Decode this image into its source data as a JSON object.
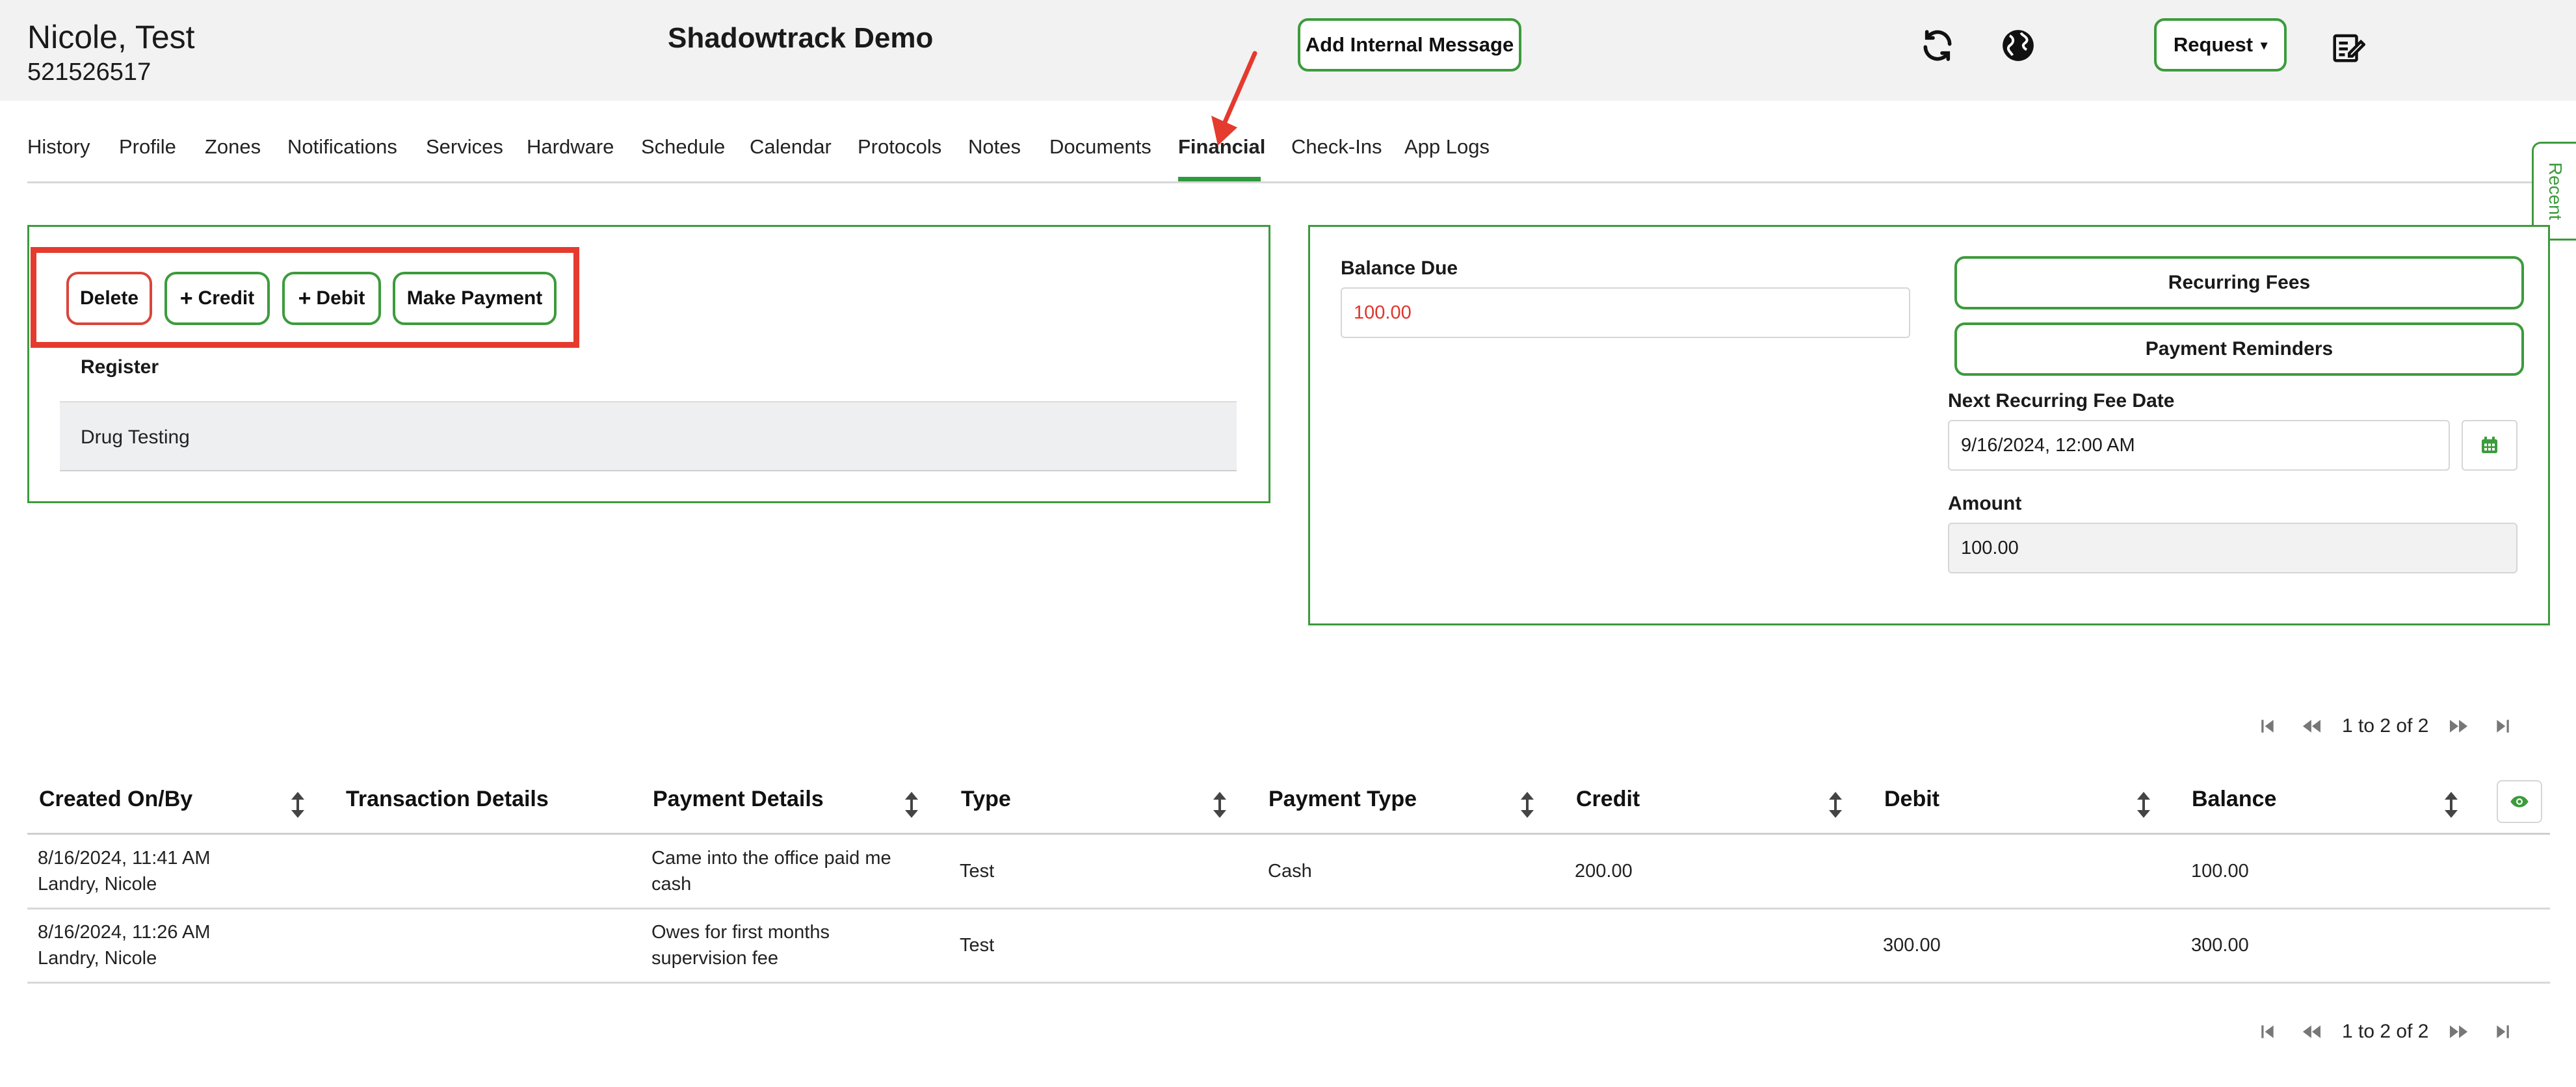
{
  "client": {
    "name": "Nicole, Test",
    "id": "521526517"
  },
  "org_name": "Shadowtrack Demo",
  "header": {
    "internal_message_label": "Add Internal Message",
    "request_label": "Request",
    "icons": [
      "refresh-icon",
      "globe-icon",
      "edit-note-icon"
    ]
  },
  "tabs": [
    {
      "label": "History"
    },
    {
      "label": "Profile"
    },
    {
      "label": "Zones"
    },
    {
      "label": "Notifications"
    },
    {
      "label": "Services"
    },
    {
      "label": "Hardware"
    },
    {
      "label": "Schedule"
    },
    {
      "label": "Calendar"
    },
    {
      "label": "Protocols"
    },
    {
      "label": "Notes"
    },
    {
      "label": "Documents"
    },
    {
      "label": "Financial",
      "active": true
    },
    {
      "label": "Check-Ins"
    },
    {
      "label": "App Logs"
    }
  ],
  "recent_label": "Recent",
  "actions": {
    "delete": "Delete",
    "credit": "Credit",
    "debit": "Debit",
    "make_payment": "Make Payment"
  },
  "register": {
    "header": "Register",
    "rows": [
      "Drug Testing"
    ]
  },
  "balance": {
    "label": "Balance Due",
    "value": "100.00"
  },
  "right_buttons": {
    "recurring_fees": "Recurring Fees",
    "payment_reminders": "Payment Reminders"
  },
  "next_fee": {
    "label": "Next Recurring Fee Date",
    "value": "9/16/2024, 12:00 AM"
  },
  "amount": {
    "label": "Amount",
    "value": "100.00"
  },
  "pager": {
    "text": "1 to 2 of 2"
  },
  "table": {
    "columns": [
      "Created On/By",
      "Transaction Details",
      "Payment Details",
      "Type",
      "Payment Type",
      "Credit",
      "Debit",
      "Balance"
    ],
    "rows": [
      {
        "created_on": "8/16/2024, 11:41 AM",
        "created_by": "Landry, Nicole",
        "transaction_details": "",
        "payment_details_1": "Came into the office paid me",
        "payment_details_2": "cash",
        "type": "Test",
        "payment_type": "Cash",
        "credit": "200.00",
        "debit": "",
        "balance": "100.00"
      },
      {
        "created_on": "8/16/2024, 11:26 AM",
        "created_by": "Landry, Nicole",
        "transaction_details": "",
        "payment_details_1": "Owes for first months",
        "payment_details_2": "supervision fee",
        "type": "Test",
        "payment_type": "",
        "credit": "",
        "debit": "300.00",
        "balance": "300.00"
      }
    ]
  },
  "colors": {
    "accent_green": "#3c9b3c",
    "annotation_red": "#e53a2e",
    "balance_red": "#e0352b"
  }
}
